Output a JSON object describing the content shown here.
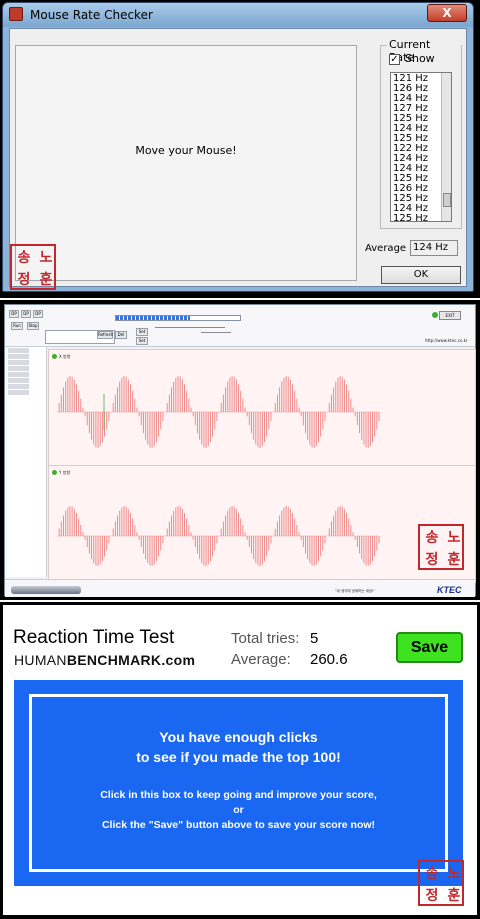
{
  "mouse_rate_checker": {
    "window_title": "Mouse Rate Checker",
    "close_glyph": "X",
    "move_prompt": "Move your Mouse!",
    "group_label": "Current Rate",
    "show_check": "✓",
    "show_label": "Show",
    "rates": [
      "121 Hz",
      "126 Hz",
      "124 Hz",
      "127 Hz",
      "125 Hz",
      "124 Hz",
      "125 Hz",
      "122 Hz",
      "124 Hz",
      "124 Hz",
      "125 Hz",
      "126 Hz",
      "125 Hz",
      "124 Hz",
      "125 Hz"
    ],
    "average_label": "Average",
    "average_value": "124 Hz",
    "ok_label": "OK"
  },
  "scope_app": {
    "toolbar_buttons": [
      "DP",
      "DP",
      "DP",
      "Run",
      "Stop",
      "Refresh",
      "Del",
      "Set",
      "Set"
    ],
    "exit_label": "EXIT",
    "url": "http://www.ktec.co.kr",
    "x_channel_label": "X 방향",
    "y_channel_label": "Y 방향",
    "slogan": "\"내 생각에 공제하는 세상!\"",
    "brand": "KTEC",
    "progress": 0.6
  },
  "reaction_test": {
    "title": "Reaction Time Test",
    "site_prefix": "HUMAN",
    "site_suffix": "BENCHMARK.com",
    "tries_label": "Total tries:",
    "tries_value": "5",
    "average_label": "Average:",
    "average_value": "260.6",
    "save_label": "Save",
    "line1": "You have enough clicks",
    "line2": "to see if you made the top 100!",
    "line3": "Click in this box to keep going and improve your score,",
    "line4": "or",
    "line5": "Click the \"Save\" button above to save your score now!",
    "colors": {
      "box_blue": "#1a67f2",
      "save_green": "#3ee21f",
      "seal_red": "#c0282d"
    }
  },
  "seal": {
    "chars": [
      "송",
      "노",
      "정",
      "훈"
    ]
  }
}
